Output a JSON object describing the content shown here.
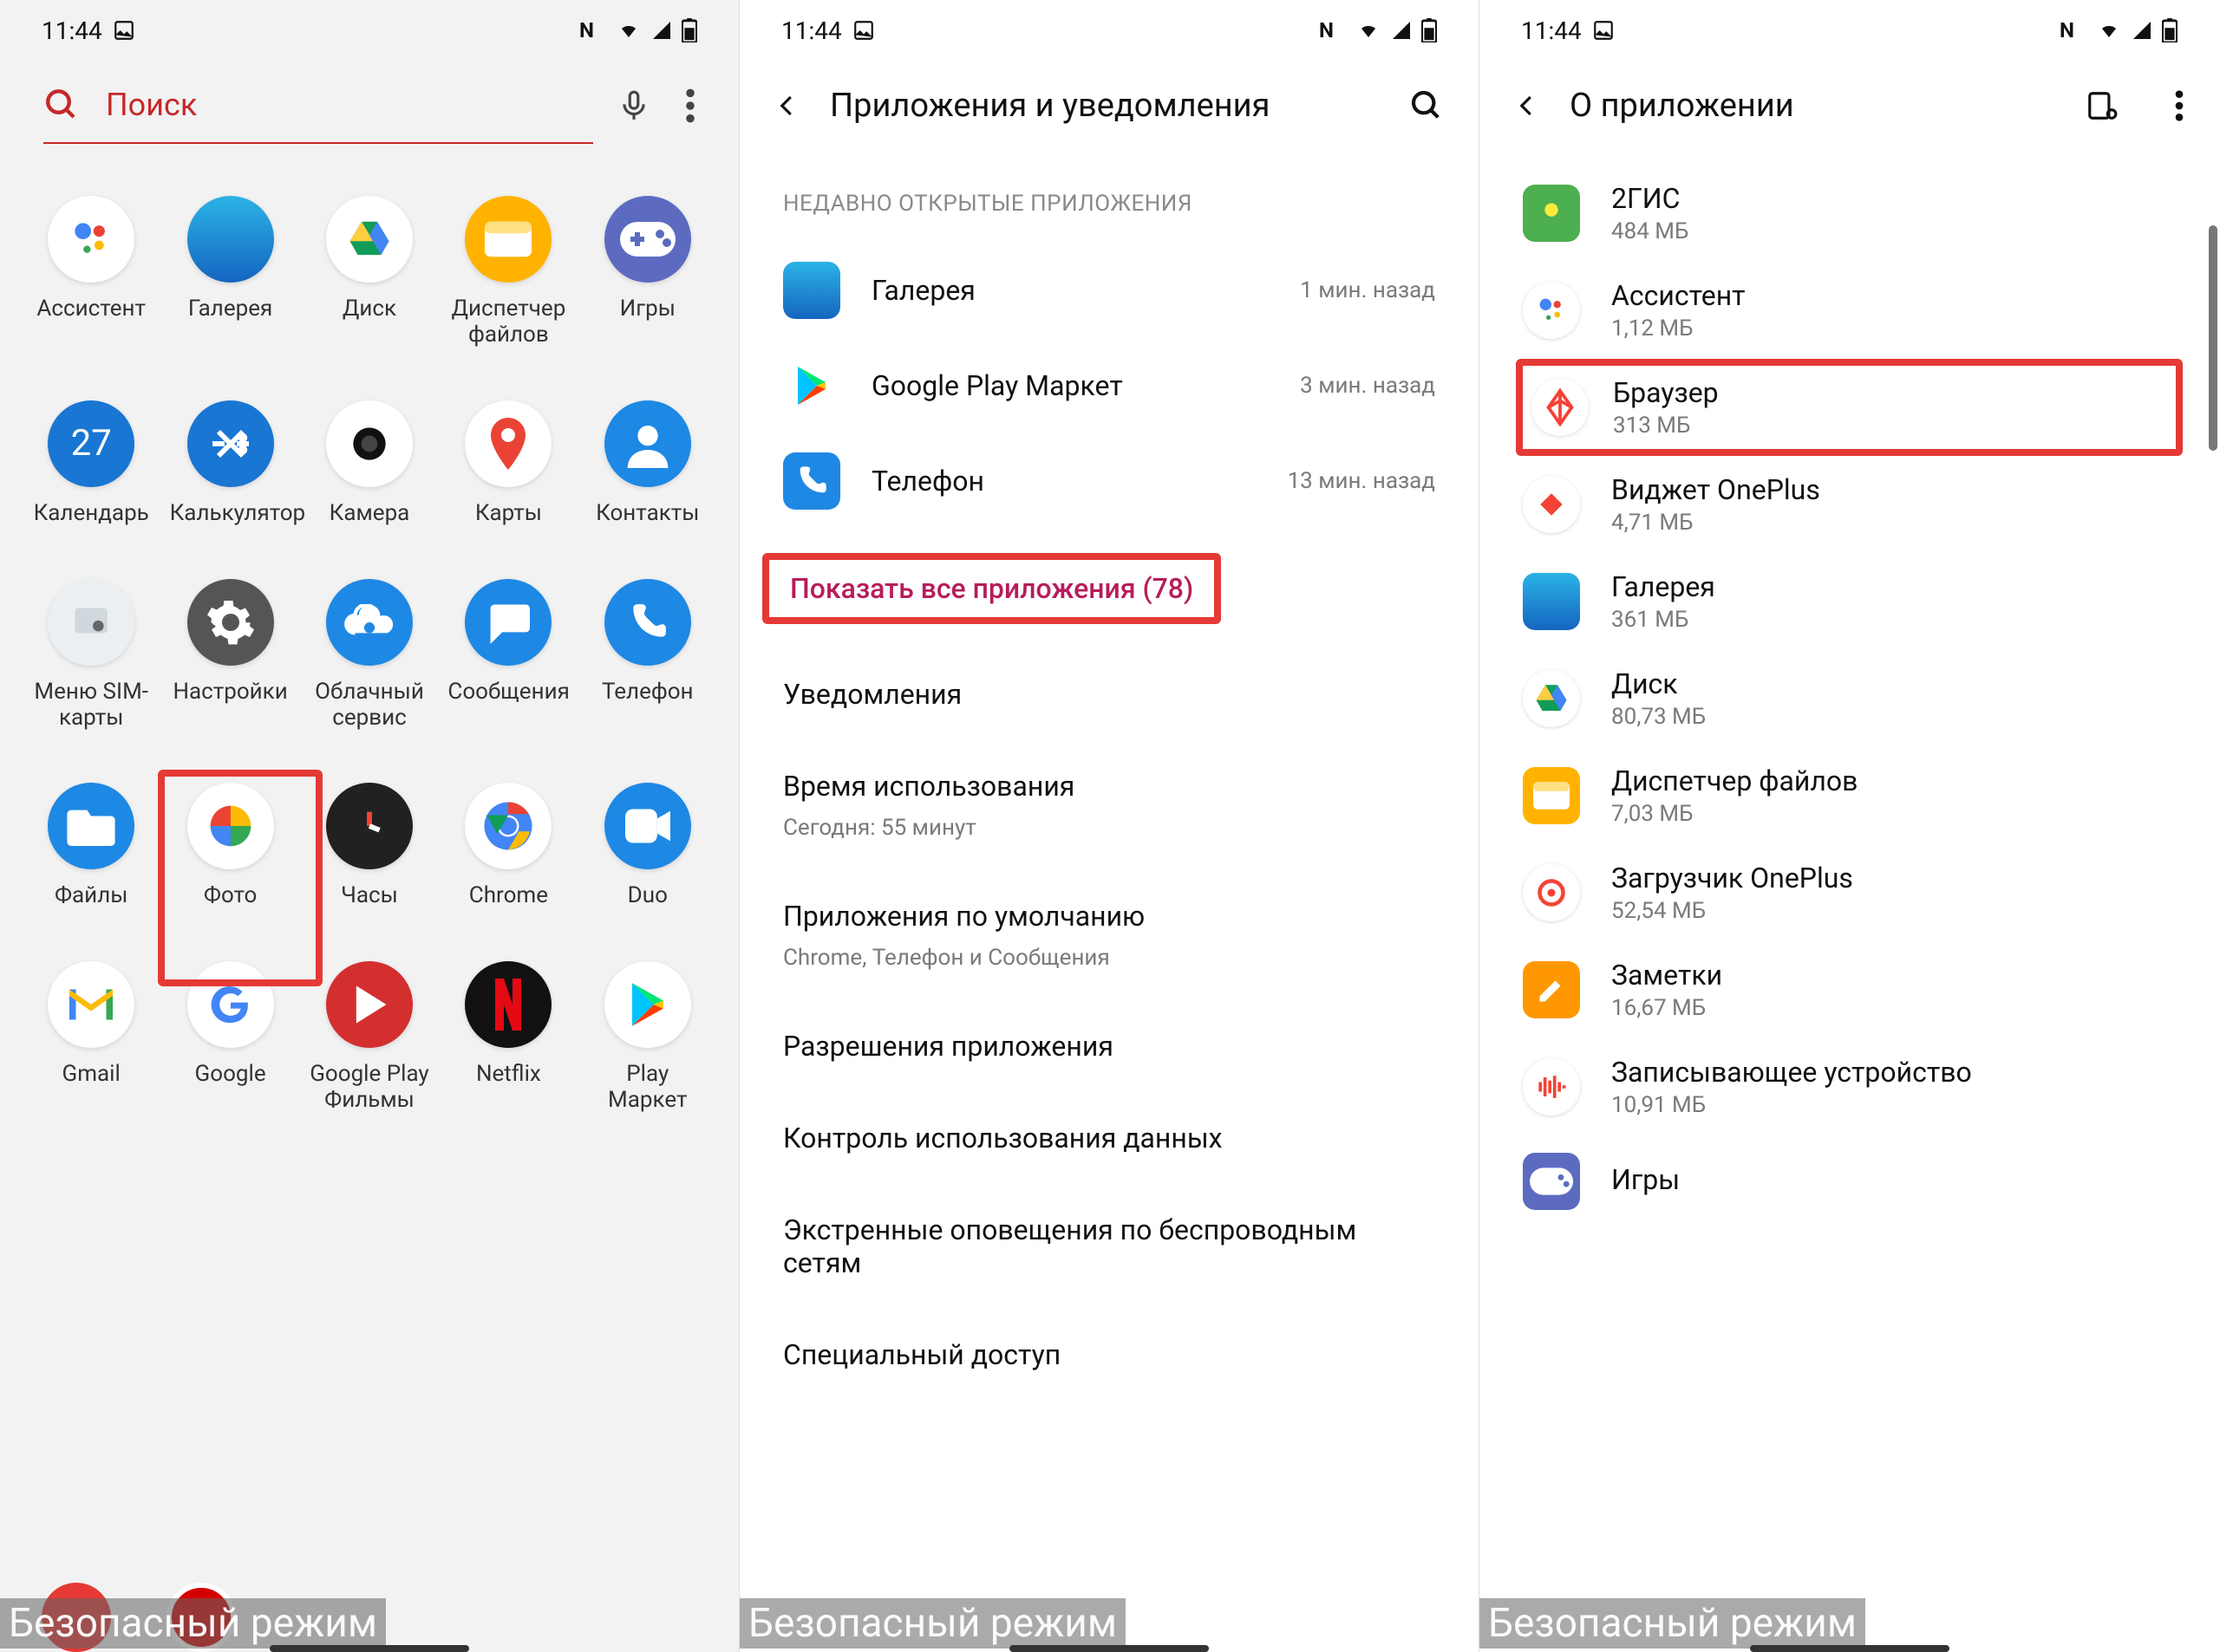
{
  "status": {
    "time": "11:44",
    "safe_mode": "Безопасный режим"
  },
  "p1": {
    "search_placeholder": "Поиск",
    "apps": [
      {
        "label": "Ассистент",
        "bg": "#fff"
      },
      {
        "label": "Галерея",
        "bg": "linear-gradient(#2bb3e6,#1565c0)"
      },
      {
        "label": "Диск",
        "bg": "#fff"
      },
      {
        "label": "Диспетчер файлов",
        "bg": "#ffb300"
      },
      {
        "label": "Игры",
        "bg": "#5c6bc0"
      },
      {
        "label": "Календарь",
        "bg": "#1976d2",
        "txt": "27"
      },
      {
        "label": "Калькулятор",
        "bg": "#1976d2"
      },
      {
        "label": "Камера",
        "bg": "#fff"
      },
      {
        "label": "Карты",
        "bg": "#fff"
      },
      {
        "label": "Контакты",
        "bg": "#1e88e5"
      },
      {
        "label": "Меню SIM-карты",
        "bg": "#eceff1"
      },
      {
        "label": "Настройки",
        "bg": "#555"
      },
      {
        "label": "Облачный сервис",
        "bg": "#1e88e5"
      },
      {
        "label": "Сообщения",
        "bg": "#1e88e5"
      },
      {
        "label": "Телефон",
        "bg": "#1e88e5"
      },
      {
        "label": "Файлы",
        "bg": "#1e88e5"
      },
      {
        "label": "Фото",
        "bg": "#fff"
      },
      {
        "label": "Часы",
        "bg": "#212121"
      },
      {
        "label": "Chrome",
        "bg": "#fff"
      },
      {
        "label": "Duo",
        "bg": "#1e88e5"
      },
      {
        "label": "Gmail",
        "bg": "#fff"
      },
      {
        "label": "Google",
        "bg": "#fff"
      },
      {
        "label": "Google Play Фильмы",
        "bg": "#d32f2f"
      },
      {
        "label": "Netflix",
        "bg": "#111"
      },
      {
        "label": "Play Маркет",
        "bg": "#fff"
      }
    ]
  },
  "p2": {
    "title": "Приложения и уведомления",
    "subhead": "НЕДАВНО ОТКРЫТЫЕ ПРИЛОЖЕНИЯ",
    "recent": [
      {
        "label": "Галерея",
        "time": "1 мин. назад",
        "bg": "linear-gradient(#2bb3e6,#1565c0)"
      },
      {
        "label": "Google Play Маркет",
        "time": "3 мин. назад",
        "bg": "#fff"
      },
      {
        "label": "Телефон",
        "time": "13 мин. назад",
        "bg": "#1e88e5"
      }
    ],
    "show_all": "Показать все приложения (78)",
    "menus": [
      {
        "title": "Уведомления"
      },
      {
        "title": "Время использования",
        "sub": "Сегодня: 55 минут"
      },
      {
        "title": "Приложения по умолчанию",
        "sub": "Chrome, Телефон и Сообщения"
      },
      {
        "title": "Разрешения приложения"
      },
      {
        "title": "Контроль использования данных"
      },
      {
        "title": "Экстренные оповещения по беспроводным сетям"
      },
      {
        "title": "Специальный доступ"
      }
    ]
  },
  "p3": {
    "title": "О приложении",
    "apps": [
      {
        "name": "2ГИС",
        "size": "484 МБ",
        "bg": "#4caf50",
        "circ": false
      },
      {
        "name": "Ассистент",
        "size": "1,12 МБ",
        "bg": "#fff",
        "circ": true
      },
      {
        "name": "Браузер",
        "size": "313 МБ",
        "bg": "#fff",
        "circ": true,
        "hl": true
      },
      {
        "name": "Виджет OnePlus",
        "size": "4,71 МБ",
        "bg": "#fff",
        "circ": true
      },
      {
        "name": "Галерея",
        "size": "361 МБ",
        "bg": "linear-gradient(#2bb3e6,#1565c0)",
        "circ": false
      },
      {
        "name": "Диск",
        "size": "80,73 МБ",
        "bg": "#fff",
        "circ": true
      },
      {
        "name": "Диспетчер файлов",
        "size": "7,03 МБ",
        "bg": "#ffb300",
        "circ": false
      },
      {
        "name": "Загрузчик OnePlus",
        "size": "52,54 МБ",
        "bg": "#fff",
        "circ": true
      },
      {
        "name": "Заметки",
        "size": "16,67 МБ",
        "bg": "#ff9800",
        "circ": false
      },
      {
        "name": "Записывающее устройство",
        "size": "10,91 МБ",
        "bg": "#fff",
        "circ": true
      },
      {
        "name": "Игры",
        "size": "",
        "bg": "#5c6bc0",
        "circ": false
      }
    ]
  }
}
